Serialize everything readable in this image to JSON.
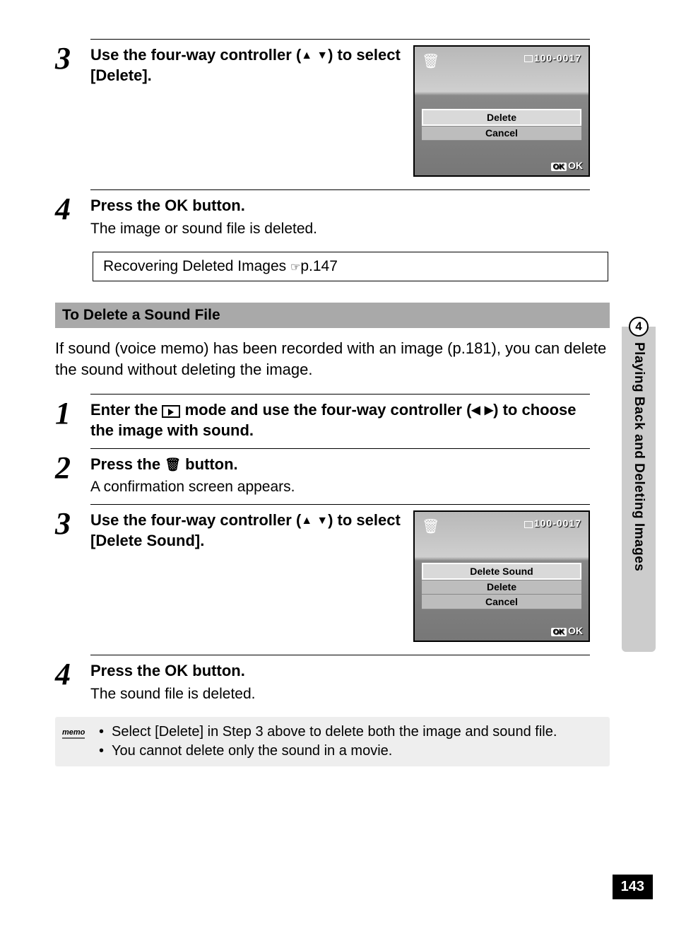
{
  "section1": {
    "step3": {
      "num": "3",
      "head_a": "Use the four-way controller (",
      "head_b": ") to select [Delete].",
      "screenshot": {
        "folder": "100-0017",
        "items": [
          "Delete",
          "Cancel"
        ],
        "ok_label": "OK",
        "ok_box": "OK"
      }
    },
    "step4": {
      "num": "4",
      "head_a": "Press the ",
      "head_ok": "OK",
      "head_b": " button.",
      "desc": "The image or sound file is deleted."
    },
    "ref": {
      "text": "Recovering Deleted Images ",
      "page": "p.147"
    }
  },
  "subheader": "To Delete a Sound File",
  "intro": "If sound (voice memo) has been recorded with an image (p.181), you can delete the sound without deleting the image.",
  "section2": {
    "step1": {
      "num": "1",
      "head_a": "Enter the ",
      "head_b": " mode and use the four-way controller (",
      "head_c": ") to choose the image with sound."
    },
    "step2": {
      "num": "2",
      "head_a": "Press the ",
      "head_b": " button.",
      "desc": "A confirmation screen appears."
    },
    "step3": {
      "num": "3",
      "head_a": "Use the four-way controller (",
      "head_b": ") to select [Delete Sound].",
      "screenshot": {
        "folder": "100-0017",
        "items": [
          "Delete Sound",
          "Delete",
          "Cancel"
        ],
        "ok_label": "OK",
        "ok_box": "OK"
      }
    },
    "step4": {
      "num": "4",
      "head_a": "Press the ",
      "head_ok": "OK",
      "head_b": " button.",
      "desc": "The sound file is deleted."
    }
  },
  "memo": {
    "label": "memo",
    "items": [
      "Select [Delete] in Step 3 above to delete both the image and sound file.",
      "You cannot delete only the sound in a movie."
    ]
  },
  "sidetab": {
    "num": "4",
    "text": "Playing Back and Deleting Images"
  },
  "pagenum": "143"
}
